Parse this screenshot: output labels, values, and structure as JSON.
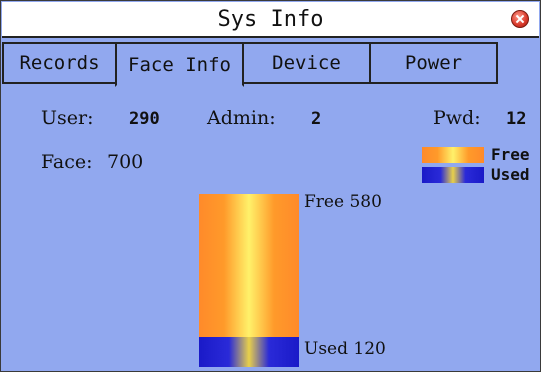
{
  "window": {
    "title": "Sys Info",
    "close_icon": "close-icon"
  },
  "tabs": [
    {
      "label": "Records",
      "active": false
    },
    {
      "label": "Face Info",
      "active": true
    },
    {
      "label": "Device",
      "active": false
    },
    {
      "label": "Power",
      "active": false
    }
  ],
  "stats": {
    "user_label": "User:",
    "user_value": "290",
    "admin_label": "Admin:",
    "admin_value": "2",
    "pwd_label": "Pwd:",
    "pwd_value": "12",
    "face_label": "Face:",
    "face_value": "700"
  },
  "legend": {
    "free_label": "Free",
    "used_label": "Used"
  },
  "chart": {
    "free_label": "Free 580",
    "used_label": "Used 120",
    "free_value": 580,
    "used_value": 120,
    "total": 700
  },
  "colors": {
    "background": "#91a8ef",
    "free": "#ff8a2a",
    "used": "#1a1ac8"
  }
}
